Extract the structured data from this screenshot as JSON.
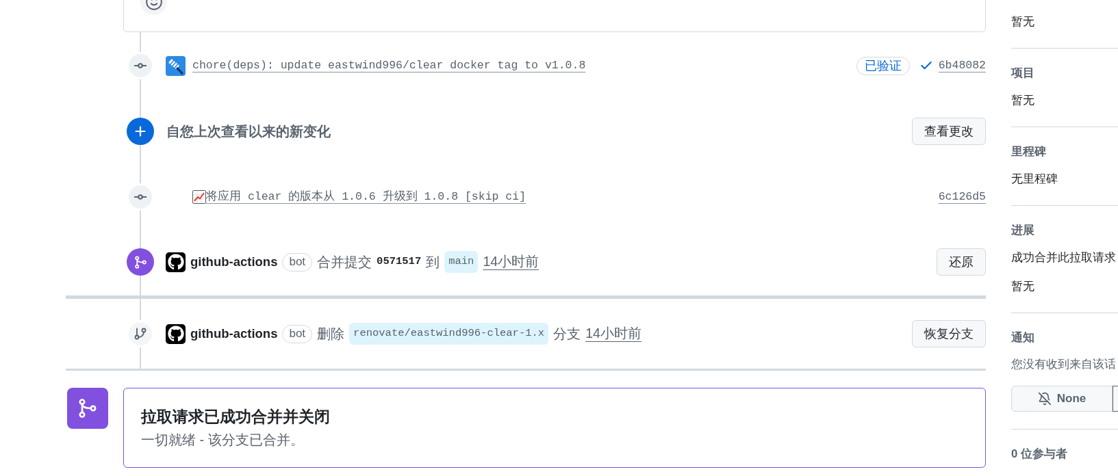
{
  "timeline": [
    {
      "kind": "commit",
      "avatar": true,
      "emoji": false,
      "message": "chore(deps): update eastwind996/clear docker tag to v1.0.8",
      "verified": "已验证",
      "ci_passed": true,
      "sha": "6b48082"
    },
    {
      "kind": "new_changes",
      "title": "自您上次查看以来的新变化",
      "button": "查看更改"
    },
    {
      "kind": "commit",
      "avatar": false,
      "emoji": true,
      "message": "将应用 clear 的版本从 1.0.6 升级到 1.0.8 [skip ci]",
      "ci_passed": false,
      "sha": "6c126d5"
    },
    {
      "kind": "merged",
      "actor": "github-actions",
      "actor_badge": "bot",
      "action": "合并提交",
      "commit": "0571517",
      "connector": "到",
      "branch": "main",
      "time": "14小时前",
      "button": "还原"
    }
  ],
  "post_merge_events": [
    {
      "kind": "branch_deleted",
      "actor": "github-actions",
      "actor_badge": "bot",
      "action": "删除",
      "branch": "renovate/eastwind996-clear-1.x",
      "suffix": "分支",
      "time": "14小时前",
      "button": "恢复分支"
    }
  ],
  "merge_status": {
    "merged": true,
    "title": "拉取请求已成功合并并关闭",
    "description": "一切就绪 - 该分支已合并。"
  },
  "sidebar": [
    {
      "values": [
        "暂无"
      ]
    },
    {
      "heading": "项目",
      "values": [
        "暂无"
      ]
    },
    {
      "heading": "里程碑",
      "values": [
        "无里程碑"
      ]
    },
    {
      "heading": "进展",
      "values": [
        "成功合并此拉取请求",
        "暂无"
      ]
    },
    {
      "heading": "通知",
      "description": "您没有收到来自该话",
      "button": "None"
    },
    {
      "heading": "0 位参与者"
    }
  ]
}
